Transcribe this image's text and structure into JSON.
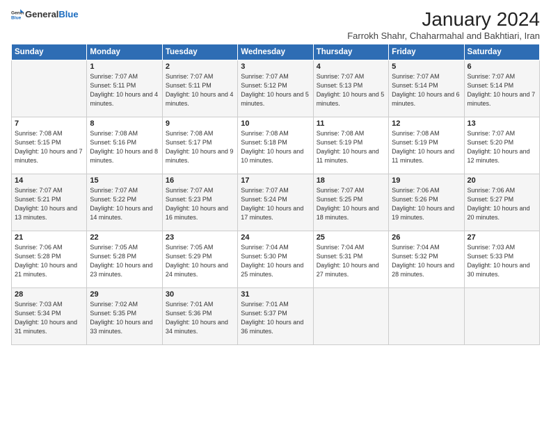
{
  "header": {
    "logo_general": "General",
    "logo_blue": "Blue",
    "month_title": "January 2024",
    "subtitle": "Farrokh Shahr, Chaharmahal and Bakhtiari, Iran"
  },
  "weekdays": [
    "Sunday",
    "Monday",
    "Tuesday",
    "Wednesday",
    "Thursday",
    "Friday",
    "Saturday"
  ],
  "weeks": [
    [
      {
        "day": "",
        "info": ""
      },
      {
        "day": "1",
        "info": "Sunrise: 7:07 AM\nSunset: 5:11 PM\nDaylight: 10 hours\nand 4 minutes."
      },
      {
        "day": "2",
        "info": "Sunrise: 7:07 AM\nSunset: 5:11 PM\nDaylight: 10 hours\nand 4 minutes."
      },
      {
        "day": "3",
        "info": "Sunrise: 7:07 AM\nSunset: 5:12 PM\nDaylight: 10 hours\nand 5 minutes."
      },
      {
        "day": "4",
        "info": "Sunrise: 7:07 AM\nSunset: 5:13 PM\nDaylight: 10 hours\nand 5 minutes."
      },
      {
        "day": "5",
        "info": "Sunrise: 7:07 AM\nSunset: 5:14 PM\nDaylight: 10 hours\nand 6 minutes."
      },
      {
        "day": "6",
        "info": "Sunrise: 7:07 AM\nSunset: 5:14 PM\nDaylight: 10 hours\nand 7 minutes."
      }
    ],
    [
      {
        "day": "7",
        "info": "Sunrise: 7:08 AM\nSunset: 5:15 PM\nDaylight: 10 hours\nand 7 minutes."
      },
      {
        "day": "8",
        "info": "Sunrise: 7:08 AM\nSunset: 5:16 PM\nDaylight: 10 hours\nand 8 minutes."
      },
      {
        "day": "9",
        "info": "Sunrise: 7:08 AM\nSunset: 5:17 PM\nDaylight: 10 hours\nand 9 minutes."
      },
      {
        "day": "10",
        "info": "Sunrise: 7:08 AM\nSunset: 5:18 PM\nDaylight: 10 hours\nand 10 minutes."
      },
      {
        "day": "11",
        "info": "Sunrise: 7:08 AM\nSunset: 5:19 PM\nDaylight: 10 hours\nand 11 minutes."
      },
      {
        "day": "12",
        "info": "Sunrise: 7:08 AM\nSunset: 5:19 PM\nDaylight: 10 hours\nand 11 minutes."
      },
      {
        "day": "13",
        "info": "Sunrise: 7:07 AM\nSunset: 5:20 PM\nDaylight: 10 hours\nand 12 minutes."
      }
    ],
    [
      {
        "day": "14",
        "info": "Sunrise: 7:07 AM\nSunset: 5:21 PM\nDaylight: 10 hours\nand 13 minutes."
      },
      {
        "day": "15",
        "info": "Sunrise: 7:07 AM\nSunset: 5:22 PM\nDaylight: 10 hours\nand 14 minutes."
      },
      {
        "day": "16",
        "info": "Sunrise: 7:07 AM\nSunset: 5:23 PM\nDaylight: 10 hours\nand 16 minutes."
      },
      {
        "day": "17",
        "info": "Sunrise: 7:07 AM\nSunset: 5:24 PM\nDaylight: 10 hours\nand 17 minutes."
      },
      {
        "day": "18",
        "info": "Sunrise: 7:07 AM\nSunset: 5:25 PM\nDaylight: 10 hours\nand 18 minutes."
      },
      {
        "day": "19",
        "info": "Sunrise: 7:06 AM\nSunset: 5:26 PM\nDaylight: 10 hours\nand 19 minutes."
      },
      {
        "day": "20",
        "info": "Sunrise: 7:06 AM\nSunset: 5:27 PM\nDaylight: 10 hours\nand 20 minutes."
      }
    ],
    [
      {
        "day": "21",
        "info": "Sunrise: 7:06 AM\nSunset: 5:28 PM\nDaylight: 10 hours\nand 21 minutes."
      },
      {
        "day": "22",
        "info": "Sunrise: 7:05 AM\nSunset: 5:28 PM\nDaylight: 10 hours\nand 23 minutes."
      },
      {
        "day": "23",
        "info": "Sunrise: 7:05 AM\nSunset: 5:29 PM\nDaylight: 10 hours\nand 24 minutes."
      },
      {
        "day": "24",
        "info": "Sunrise: 7:04 AM\nSunset: 5:30 PM\nDaylight: 10 hours\nand 25 minutes."
      },
      {
        "day": "25",
        "info": "Sunrise: 7:04 AM\nSunset: 5:31 PM\nDaylight: 10 hours\nand 27 minutes."
      },
      {
        "day": "26",
        "info": "Sunrise: 7:04 AM\nSunset: 5:32 PM\nDaylight: 10 hours\nand 28 minutes."
      },
      {
        "day": "27",
        "info": "Sunrise: 7:03 AM\nSunset: 5:33 PM\nDaylight: 10 hours\nand 30 minutes."
      }
    ],
    [
      {
        "day": "28",
        "info": "Sunrise: 7:03 AM\nSunset: 5:34 PM\nDaylight: 10 hours\nand 31 minutes."
      },
      {
        "day": "29",
        "info": "Sunrise: 7:02 AM\nSunset: 5:35 PM\nDaylight: 10 hours\nand 33 minutes."
      },
      {
        "day": "30",
        "info": "Sunrise: 7:01 AM\nSunset: 5:36 PM\nDaylight: 10 hours\nand 34 minutes."
      },
      {
        "day": "31",
        "info": "Sunrise: 7:01 AM\nSunset: 5:37 PM\nDaylight: 10 hours\nand 36 minutes."
      },
      {
        "day": "",
        "info": ""
      },
      {
        "day": "",
        "info": ""
      },
      {
        "day": "",
        "info": ""
      }
    ]
  ]
}
